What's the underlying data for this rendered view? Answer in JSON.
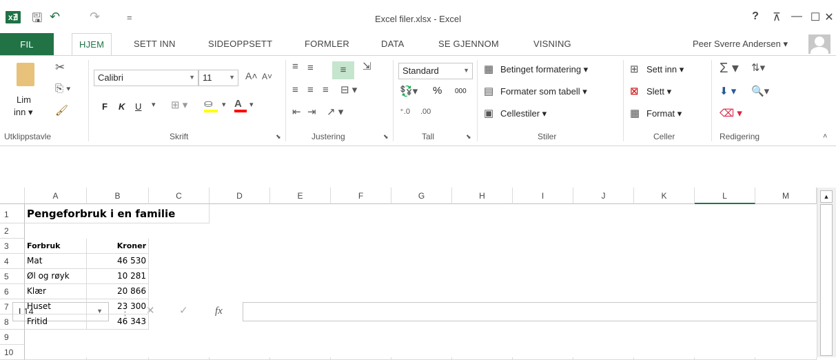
{
  "window": {
    "title": "Excel filer.xlsx - Excel",
    "help": "?",
    "ribbon_display": "⊼",
    "minimize": "—",
    "maximize": "☐",
    "close": "✕"
  },
  "qat": {
    "logo": "x∄",
    "save": "🖫",
    "undo": "↶",
    "redo": "↷",
    "customize": "="
  },
  "tabs": {
    "file": "FIL",
    "home": "HJEM",
    "insert": "SETT INN",
    "layout": "SIDEOPPSETT",
    "formulas": "FORMLER",
    "data": "DATA",
    "review": "SE GJENNOM",
    "view": "VISNING"
  },
  "user": {
    "name": "Peer Sverre Andersen",
    "arrow": "▾"
  },
  "ribbon": {
    "clipboard": {
      "label": "Utklippstavle",
      "paste": "Lim",
      "paste2": "inn ▾"
    },
    "font": {
      "label": "Skrift",
      "name": "Calibri",
      "size": "11",
      "bold": "F",
      "italic": "K",
      "underline": "U"
    },
    "alignment": {
      "label": "Justering"
    },
    "number": {
      "label": "Tall",
      "format": "Standard",
      "percent": "%",
      "thousands": "000"
    },
    "styles": {
      "label": "Stiler",
      "conditional": "Betinget formatering ▾",
      "as_table": "Formater som tabell ▾",
      "cell_styles": "Cellestiler ▾"
    },
    "cells": {
      "label": "Celler",
      "insert": "Sett inn ▾",
      "delete": "Slett ▾",
      "format": "Format ▾"
    },
    "editing": {
      "label": "Redigering"
    }
  },
  "formula_bar": {
    "name_box": "L14",
    "fx": "fx",
    "cancel": "✕",
    "enter": "✓",
    "content": ""
  },
  "sheet": {
    "columns": [
      "A",
      "B",
      "C",
      "D",
      "E",
      "F",
      "G",
      "H",
      "I",
      "J",
      "K",
      "L",
      "M"
    ],
    "rows": [
      "1",
      "2",
      "3",
      "4",
      "5",
      "6",
      "7",
      "8",
      "9",
      "10"
    ],
    "title": "Pengeforbruk i en familie",
    "header_a": "Forbruk",
    "header_b": "Kroner",
    "items": [
      {
        "label": "Mat",
        "value": "46 530"
      },
      {
        "label": "Øl og røyk",
        "value": "10 281"
      },
      {
        "label": "Klær",
        "value": "20 866"
      },
      {
        "label": "Huset",
        "value": "23 300"
      },
      {
        "label": "Fritid",
        "value": "46 343"
      }
    ]
  },
  "colors": {
    "accent": "#217346",
    "selected_col": "#217346"
  }
}
